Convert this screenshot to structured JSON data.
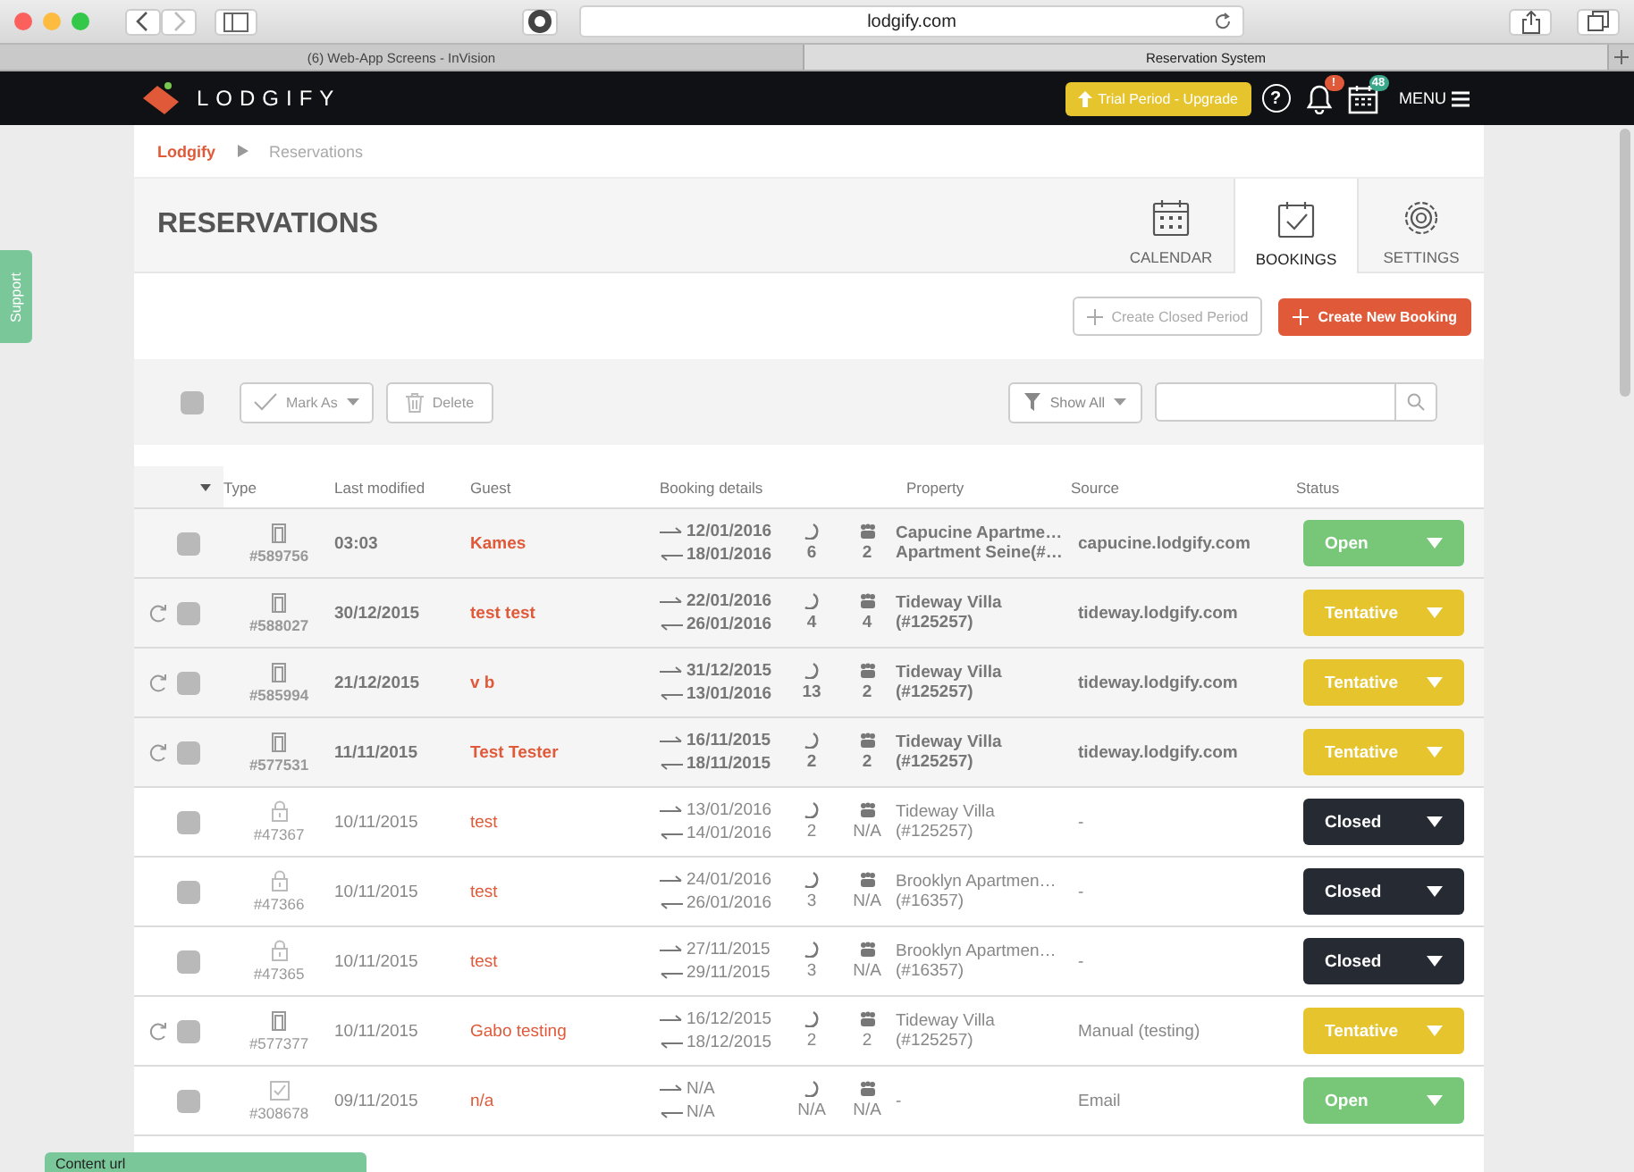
{
  "browser": {
    "url": "lodgify.com",
    "tabs": [
      {
        "label": "(6) Web-App Screens - InVision",
        "selected": false
      },
      {
        "label": "Reservation System",
        "selected": true
      }
    ]
  },
  "app_header": {
    "logo": "LODGIFY",
    "trial_button": "Trial Period - Upgrade",
    "help": "?",
    "notification_badge": "!",
    "calendar_badge": "48",
    "menu": "MENU"
  },
  "support_tab": "Support",
  "breadcrumb": [
    "Lodgify",
    "Reservations"
  ],
  "page_title": "RESERVATIONS",
  "view_tabs": [
    {
      "label": "CALENDAR",
      "kind": "calendar",
      "selected": false
    },
    {
      "label": "BOOKINGS",
      "kind": "bookings",
      "selected": true
    },
    {
      "label": "SETTINGS",
      "kind": "settings",
      "selected": false
    }
  ],
  "actions": {
    "create_closed_period": "Create Closed Period",
    "create_new_booking": "Create New Booking"
  },
  "toolbar": {
    "select_all_checked": false,
    "mark_as": "Mark As",
    "delete": "Delete",
    "filter": "Show All"
  },
  "table": {
    "columns": [
      "Type",
      "Last modified",
      "Guest",
      "Booking details",
      "Property",
      "Source",
      "Status"
    ],
    "rows": [
      {
        "highlighted": true,
        "synced": false,
        "kind": "door",
        "id": "#589756",
        "modified": "03:03",
        "guest": "Kames",
        "arrival": "12/01/2016",
        "departure": "18/01/2016",
        "nights": "6",
        "guests": "2",
        "property": [
          "Capucine Apartme…",
          "Apartment Seine(#…"
        ],
        "source": "capucine.lodgify.com",
        "status": {
          "label": "Open",
          "kind": "open"
        }
      },
      {
        "highlighted": true,
        "synced": true,
        "kind": "door",
        "id": "#588027",
        "modified": "30/12/2015",
        "guest": "test test",
        "arrival": "22/01/2016",
        "departure": "26/01/2016",
        "nights": "4",
        "guests": "4",
        "property": [
          "Tideway Villa",
          "(#125257)"
        ],
        "source": "tideway.lodgify.com",
        "status": {
          "label": "Tentative",
          "kind": "tentative"
        }
      },
      {
        "highlighted": true,
        "synced": true,
        "kind": "door",
        "id": "#585994",
        "modified": "21/12/2015",
        "guest": "v b",
        "arrival": "31/12/2015",
        "departure": "13/01/2016",
        "nights": "13",
        "guests": "2",
        "property": [
          "Tideway Villa",
          "(#125257)"
        ],
        "source": "tideway.lodgify.com",
        "status": {
          "label": "Tentative",
          "kind": "tentative"
        }
      },
      {
        "highlighted": true,
        "synced": true,
        "kind": "door",
        "id": "#577531",
        "modified": "11/11/2015",
        "guest": "Test Tester",
        "arrival": "16/11/2015",
        "departure": "18/11/2015",
        "nights": "2",
        "guests": "2",
        "property": [
          "Tideway Villa",
          "(#125257)"
        ],
        "source": "tideway.lodgify.com",
        "status": {
          "label": "Tentative",
          "kind": "tentative"
        }
      },
      {
        "highlighted": false,
        "synced": false,
        "kind": "lock",
        "id": "#47367",
        "modified": "10/11/2015",
        "guest": "test",
        "arrival": "13/01/2016",
        "departure": "14/01/2016",
        "nights": "2",
        "guests": "N/A",
        "property": [
          "Tideway Villa",
          "(#125257)"
        ],
        "source": "-",
        "status": {
          "label": "Closed",
          "kind": "closed"
        }
      },
      {
        "highlighted": false,
        "synced": false,
        "kind": "lock",
        "id": "#47366",
        "modified": "10/11/2015",
        "guest": "test",
        "arrival": "24/01/2016",
        "departure": "26/01/2016",
        "nights": "3",
        "guests": "N/A",
        "property": [
          "Brooklyn Apartmen…",
          "(#16357)"
        ],
        "source": "-",
        "status": {
          "label": "Closed",
          "kind": "closed"
        }
      },
      {
        "highlighted": false,
        "synced": false,
        "kind": "lock",
        "id": "#47365",
        "modified": "10/11/2015",
        "guest": "test",
        "arrival": "27/11/2015",
        "departure": "29/11/2015",
        "nights": "3",
        "guests": "N/A",
        "property": [
          "Brooklyn Apartmen…",
          "(#16357)"
        ],
        "source": "-",
        "status": {
          "label": "Closed",
          "kind": "closed"
        }
      },
      {
        "highlighted": false,
        "synced": true,
        "kind": "door",
        "id": "#577377",
        "modified": "10/11/2015",
        "guest": "Gabo testing",
        "arrival": "16/12/2015",
        "departure": "18/12/2015",
        "nights": "2",
        "guests": "2",
        "property": [
          "Tideway Villa",
          "(#125257)"
        ],
        "source": "Manual (testing)",
        "status": {
          "label": "Tentative",
          "kind": "tentative"
        }
      },
      {
        "highlighted": false,
        "synced": false,
        "kind": "check",
        "id": "#308678",
        "modified": "09/11/2015",
        "guest": "n/a",
        "arrival": "N/A",
        "departure": "N/A",
        "nights": "N/A",
        "guests": "N/A",
        "property": [
          "-"
        ],
        "source": "Email",
        "status": {
          "label": "Open",
          "kind": "open"
        }
      }
    ]
  },
  "content_url_bar": "Content url"
}
